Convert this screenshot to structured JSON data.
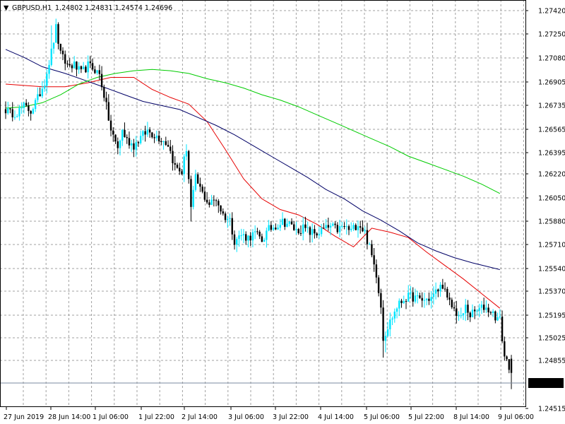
{
  "header": {
    "menu_glyph": "▼",
    "symbol_text": "GBPUSD,H1",
    "ohlc_text": "1.24802 1.24831 1.24574 1.24696"
  },
  "price_tag": "1.24696",
  "colors": {
    "bull_candle": "#00e5ff",
    "bear_candle": "#000000",
    "ma_red": "#e60000",
    "ma_navy": "#000066",
    "ma_green": "#00cc00",
    "grid": "#a0a0a0",
    "price_tag_bg": "#000000"
  },
  "chart_data": {
    "type": "candlestick",
    "title": "GBPUSD,H1",
    "y_ticks": [
      "1.27420",
      "1.27250",
      "1.27080",
      "1.26905",
      "1.26735",
      "1.26565",
      "1.26395",
      "1.26220",
      "1.26050",
      "1.25880",
      "1.25710",
      "1.25540",
      "1.25370",
      "1.25195",
      "1.25025",
      "1.24855",
      "1.24515"
    ],
    "x_ticks": [
      "27 Jun 2019",
      "28 Jun 14:00",
      "1 Jul 06:00",
      "1 Jul 22:00",
      "2 Jul 14:00",
      "3 Jul 06:00",
      "3 Jul 22:00",
      "4 Jul 14:00",
      "5 Jul 06:00",
      "5 Jul 22:00",
      "8 Jul 14:00",
      "9 Jul 06:00"
    ],
    "ylim": [
      1.2444,
      1.2749
    ],
    "grid": true,
    "last_price": 1.24696,
    "last_bar_ohlc": {
      "open": 1.24802,
      "high": 1.24831,
      "low": 1.24574,
      "close": 1.24696
    },
    "moving_averages": [
      {
        "color": "red",
        "points": [
          [
            0,
            1.2686
          ],
          [
            8,
            1.2685
          ],
          [
            16,
            1.2684
          ],
          [
            26,
            1.2684
          ],
          [
            36,
            1.2687
          ],
          [
            46,
            1.2691
          ],
          [
            56,
            1.2691
          ],
          [
            64,
            1.2682
          ],
          [
            72,
            1.2676
          ],
          [
            80,
            1.2671
          ],
          [
            88,
            1.2658
          ],
          [
            96,
            1.2637
          ],
          [
            104,
            1.2615
          ],
          [
            112,
            1.26
          ],
          [
            120,
            1.2592
          ],
          [
            128,
            1.2588
          ],
          [
            136,
            1.2581
          ],
          [
            144,
            1.2572
          ],
          [
            152,
            1.2564
          ],
          [
            160,
            1.2578
          ],
          [
            168,
            1.2575
          ],
          [
            176,
            1.2571
          ],
          [
            184,
            1.256
          ],
          [
            192,
            1.255
          ],
          [
            200,
            1.254
          ],
          [
            208,
            1.2529
          ],
          [
            216,
            1.2518
          ]
        ]
      },
      {
        "color": "navy",
        "points": [
          [
            0,
            1.2712
          ],
          [
            8,
            1.2706
          ],
          [
            16,
            1.2699
          ],
          [
            26,
            1.2694
          ],
          [
            36,
            1.2688
          ],
          [
            44,
            1.2683
          ],
          [
            52,
            1.2678
          ],
          [
            60,
            1.2673
          ],
          [
            68,
            1.267
          ],
          [
            76,
            1.2667
          ],
          [
            84,
            1.2661
          ],
          [
            92,
            1.2655
          ],
          [
            100,
            1.2648
          ],
          [
            108,
            1.264
          ],
          [
            116,
            1.2632
          ],
          [
            124,
            1.2624
          ],
          [
            132,
            1.2616
          ],
          [
            140,
            1.2607
          ],
          [
            148,
            1.26
          ],
          [
            156,
            1.2591
          ],
          [
            164,
            1.2584
          ],
          [
            172,
            1.2576
          ],
          [
            180,
            1.2567
          ],
          [
            188,
            1.2561
          ],
          [
            196,
            1.2556
          ],
          [
            204,
            1.2552
          ],
          [
            216,
            1.2547
          ]
        ]
      },
      {
        "color": "green",
        "points": [
          [
            0,
            1.2668
          ],
          [
            8,
            1.2669
          ],
          [
            16,
            1.2672
          ],
          [
            24,
            1.2678
          ],
          [
            32,
            1.2686
          ],
          [
            40,
            1.2691
          ],
          [
            48,
            1.2694
          ],
          [
            56,
            1.2696
          ],
          [
            64,
            1.2697
          ],
          [
            72,
            1.2696
          ],
          [
            80,
            1.2694
          ],
          [
            88,
            1.269
          ],
          [
            96,
            1.2687
          ],
          [
            104,
            1.2683
          ],
          [
            112,
            1.2678
          ],
          [
            120,
            1.2674
          ],
          [
            128,
            1.2669
          ],
          [
            136,
            1.2663
          ],
          [
            144,
            1.2657
          ],
          [
            152,
            1.2651
          ],
          [
            160,
            1.2645
          ],
          [
            168,
            1.2639
          ],
          [
            176,
            1.2632
          ],
          [
            184,
            1.2627
          ],
          [
            192,
            1.2622
          ],
          [
            200,
            1.2617
          ],
          [
            208,
            1.2611
          ],
          [
            216,
            1.2604
          ]
        ]
      }
    ],
    "anchors": [
      [
        0,
        1.2667
      ],
      [
        2,
        1.2664
      ],
      [
        5,
        1.2665
      ],
      [
        8,
        1.2669
      ],
      [
        11,
        1.2666
      ],
      [
        14,
        1.2675
      ],
      [
        17,
        1.2688
      ],
      [
        20,
        1.271
      ],
      [
        22,
        1.2728
      ],
      [
        24,
        1.2708
      ],
      [
        27,
        1.27
      ],
      [
        30,
        1.27
      ],
      [
        33,
        1.2694
      ],
      [
        36,
        1.27
      ],
      [
        39,
        1.2697
      ],
      [
        41,
        1.2693
      ],
      [
        43,
        1.2678
      ],
      [
        46,
        1.2651
      ],
      [
        49,
        1.2638
      ],
      [
        51,
        1.2651
      ],
      [
        53,
        1.2644
      ],
      [
        56,
        1.264
      ],
      [
        59,
        1.2646
      ],
      [
        62,
        1.2651
      ],
      [
        65,
        1.2648
      ],
      [
        68,
        1.2645
      ],
      [
        71,
        1.2641
      ],
      [
        74,
        1.2624
      ],
      [
        77,
        1.262
      ],
      [
        79,
        1.2638
      ],
      [
        81,
        1.2593
      ],
      [
        83,
        1.2615
      ],
      [
        86,
        1.2604
      ],
      [
        89,
        1.2596
      ],
      [
        92,
        1.26
      ],
      [
        95,
        1.2588
      ],
      [
        98,
        1.2584
      ],
      [
        100,
        1.2569
      ],
      [
        103,
        1.2573
      ],
      [
        106,
        1.2571
      ],
      [
        109,
        1.2574
      ],
      [
        112,
        1.2569
      ],
      [
        115,
        1.2577
      ],
      [
        118,
        1.258
      ],
      [
        121,
        1.2583
      ],
      [
        124,
        1.2581
      ],
      [
        127,
        1.2576
      ],
      [
        130,
        1.2578
      ],
      [
        133,
        1.2575
      ],
      [
        136,
        1.2574
      ],
      [
        139,
        1.2577
      ],
      [
        142,
        1.2579
      ],
      [
        145,
        1.2577
      ],
      [
        148,
        1.2579
      ],
      [
        151,
        1.2576
      ],
      [
        154,
        1.2582
      ],
      [
        157,
        1.2575
      ],
      [
        160,
        1.2557
      ],
      [
        162,
        1.2544
      ],
      [
        164,
        1.252
      ],
      [
        165,
        1.2496
      ],
      [
        168,
        1.2508
      ],
      [
        171,
        1.2519
      ],
      [
        174,
        1.2525
      ],
      [
        177,
        1.2527
      ],
      [
        180,
        1.2525
      ],
      [
        183,
        1.2524
      ],
      [
        186,
        1.2526
      ],
      [
        189,
        1.2532
      ],
      [
        191,
        1.2536
      ],
      [
        193,
        1.2524
      ],
      [
        196,
        1.2517
      ],
      [
        199,
        1.251
      ],
      [
        201,
        1.2519
      ],
      [
        203,
        1.2513
      ],
      [
        206,
        1.2516
      ],
      [
        209,
        1.2519
      ],
      [
        212,
        1.2516
      ],
      [
        214,
        1.2512
      ],
      [
        216,
        1.2509
      ],
      [
        218,
        1.2482
      ],
      [
        220,
        1.2475
      ],
      [
        221,
        1.24696
      ]
    ]
  }
}
